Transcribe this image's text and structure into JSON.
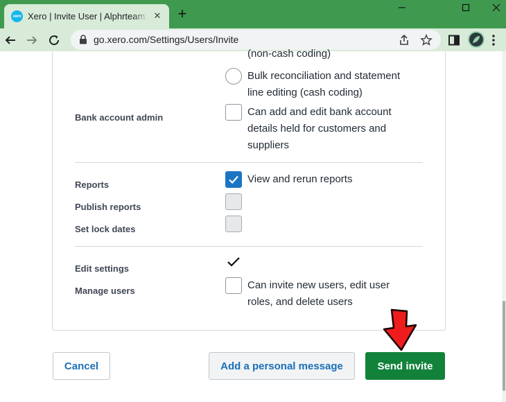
{
  "browser": {
    "tab_title": "Xero | Invite User | Alphrteam.com",
    "tab_favicon_text": "xero",
    "url": "go.xero.com/Settings/Users/Invite",
    "accent_color": "#3f9a4f"
  },
  "permissions": {
    "partial_top_text": "(non-cash coding)",
    "bulk_reconciliation": {
      "line1": "Bulk reconciliation and statement",
      "line2": "line editing (cash coding)"
    },
    "bank_account_admin": {
      "label": "Bank account admin",
      "line1": "Can add and edit bank account",
      "line2": "details held for customers and",
      "line3": "suppliers"
    },
    "reports": {
      "label": "Reports",
      "option": "View and rerun reports",
      "checked": true
    },
    "publish_reports": {
      "label": "Publish reports"
    },
    "set_lock_dates": {
      "label": "Set lock dates"
    },
    "edit_settings": {
      "label": "Edit settings"
    },
    "manage_users": {
      "label": "Manage users",
      "line1": "Can invite new users, edit user",
      "line2": "roles, and delete users"
    }
  },
  "footer": {
    "cancel_label": "Cancel",
    "message_label": "Add a personal message",
    "send_label": "Send invite",
    "send_color": "#12823b"
  }
}
